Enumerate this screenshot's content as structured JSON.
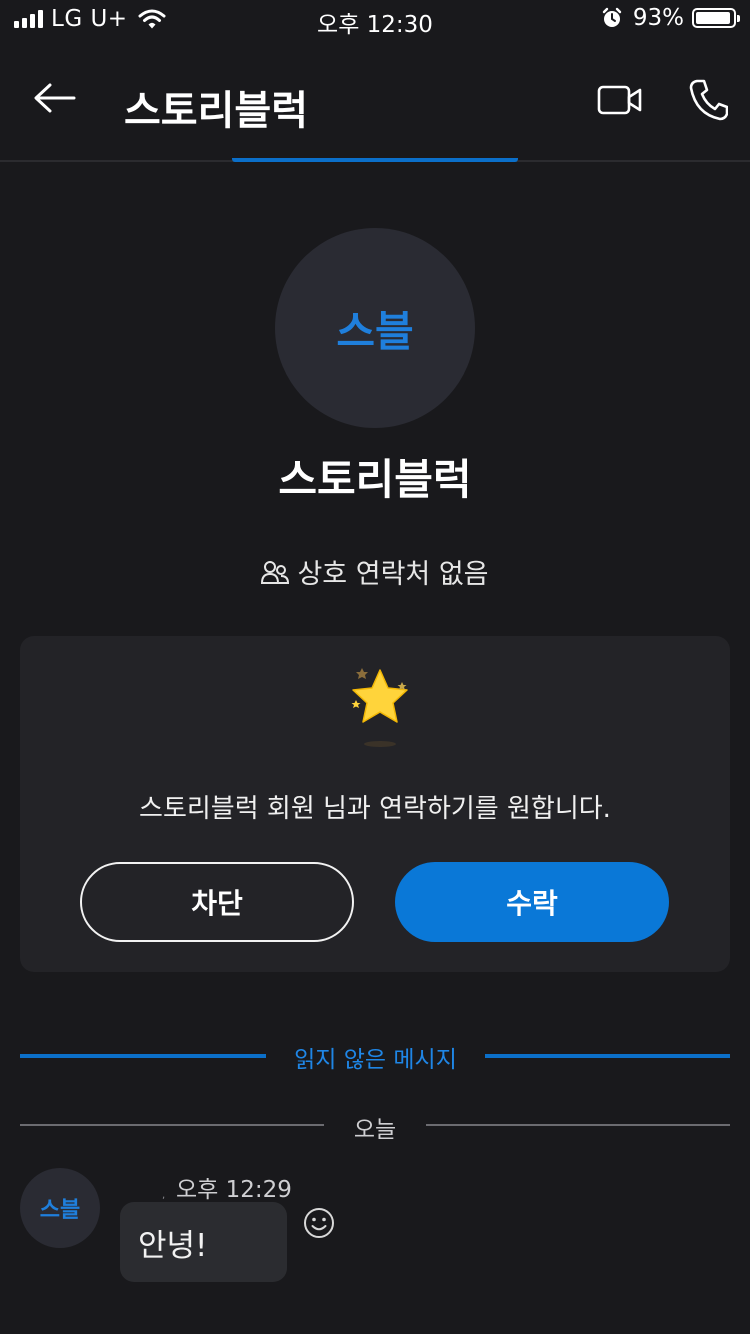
{
  "status_bar": {
    "carrier": "LG U+",
    "time": "오후 12:30",
    "battery_percent": "93%",
    "battery_level": 0.93,
    "icons": [
      "signal-icon",
      "wifi-icon",
      "alarm-icon",
      "battery-icon"
    ]
  },
  "header": {
    "title": "스토리블럭",
    "icons": [
      "back-arrow-icon",
      "video-call-icon",
      "phone-icon"
    ]
  },
  "profile": {
    "avatar_initials": "스블",
    "name": "스토리블럭",
    "mutual_contacts": "상호 연락처 없음"
  },
  "request_card": {
    "message": "스토리블럭 회원 님과 연락하기를 원합니다.",
    "block_label": "차단",
    "accept_label": "수락"
  },
  "dividers": {
    "unread": "읽지 않은 메시지",
    "today": "오늘"
  },
  "message": {
    "avatar_initials": "스블",
    "time": "오후 12:29",
    "text": "안녕!"
  },
  "colors": {
    "background": "#19191c",
    "accent": "#0a78d7",
    "card": "#232327"
  }
}
